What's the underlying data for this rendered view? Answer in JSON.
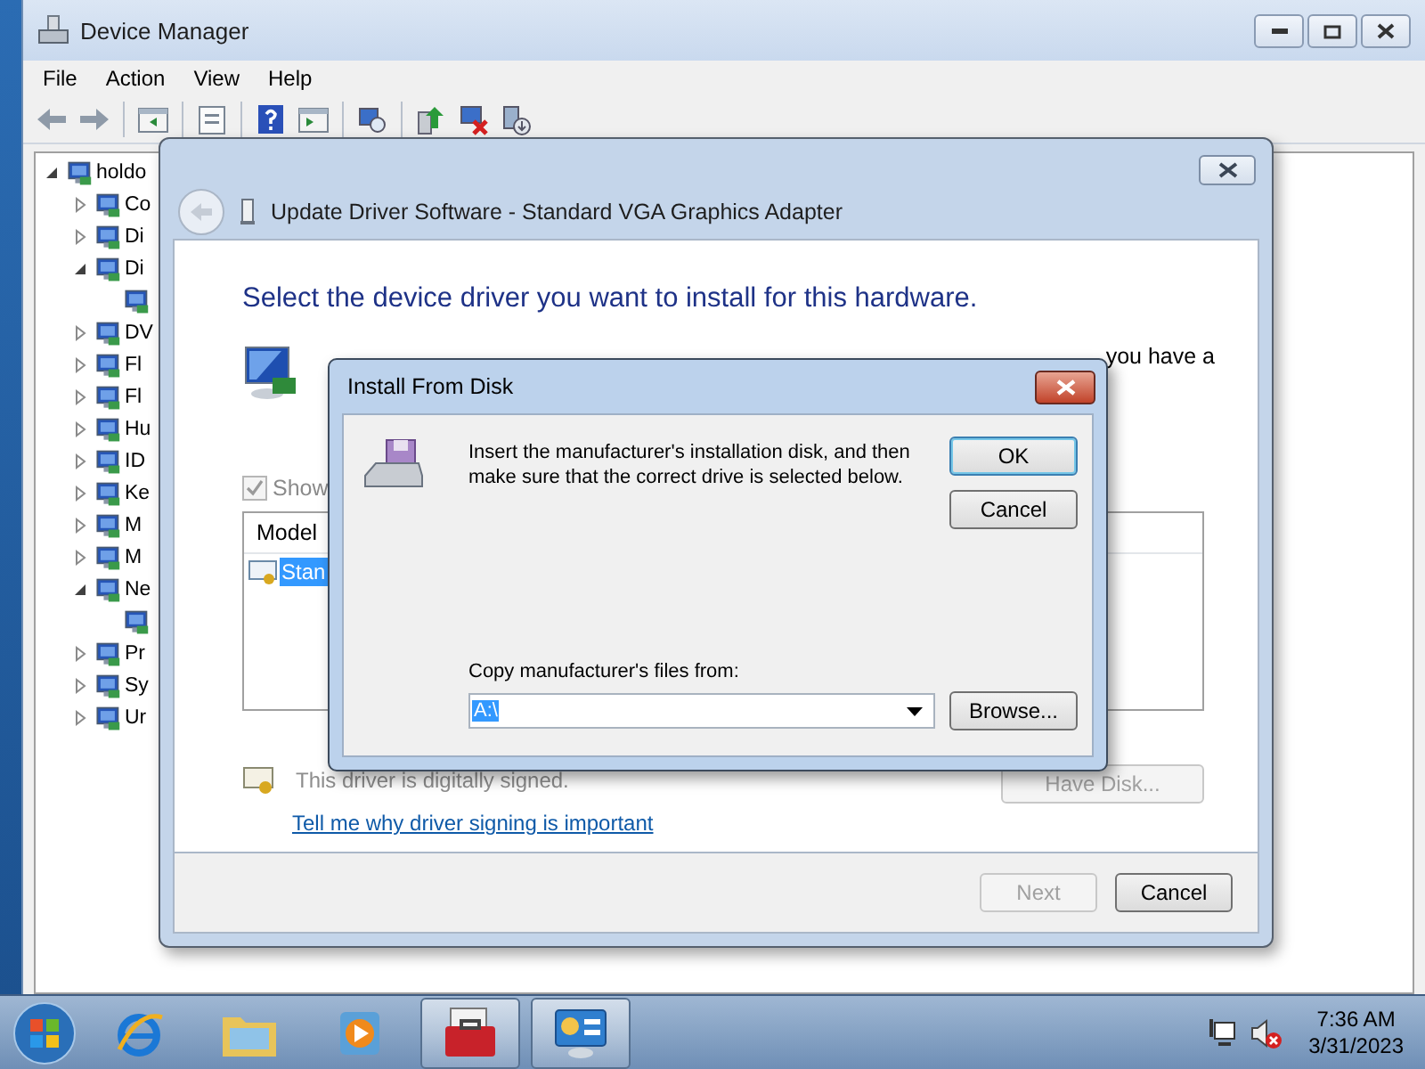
{
  "device_manager": {
    "title": "Device Manager",
    "menu": [
      "File",
      "Action",
      "View",
      "Help"
    ],
    "tree": [
      {
        "label": "holdo",
        "expanded": true,
        "children": [
          {
            "label": "Co",
            "expanded": false
          },
          {
            "label": "Di",
            "expanded": false
          },
          {
            "label": "Di",
            "expanded": true,
            "children": [
              {
                "kind": "device"
              }
            ]
          },
          {
            "label": "DV",
            "expanded": false
          },
          {
            "label": "Fl",
            "expanded": false
          },
          {
            "label": "Fl",
            "expanded": false
          },
          {
            "label": "Hu",
            "expanded": false
          },
          {
            "label": "ID",
            "expanded": false
          },
          {
            "label": "Ke",
            "expanded": false
          },
          {
            "label": "M",
            "expanded": false
          },
          {
            "label": "M",
            "expanded": false
          },
          {
            "label": "Ne",
            "expanded": true,
            "children": [
              {
                "kind": "device"
              }
            ]
          },
          {
            "label": "Pr",
            "expanded": false
          },
          {
            "label": "Sy",
            "expanded": false
          },
          {
            "label": "Ur",
            "expanded": false
          }
        ]
      }
    ]
  },
  "update_driver": {
    "title": "Update Driver Software - Standard VGA Graphics Adapter",
    "heading": "Select the device driver you want to install for this hardware.",
    "description": "you have a",
    "show_compatible": {
      "label": "Show",
      "checked": true,
      "disabled": true
    },
    "list": {
      "columns": [
        "Model"
      ],
      "rows": [
        {
          "label": "Stan",
          "selected": true
        }
      ]
    },
    "signed_text": "This driver is digitally signed.",
    "have_disk": "Have Disk...",
    "link": "Tell me why driver signing is important",
    "buttons": [
      {
        "label": "Next",
        "disabled": true
      },
      {
        "label": "Cancel",
        "disabled": false
      }
    ]
  },
  "install_from_disk": {
    "title": "Install From Disk",
    "message": "Insert the manufacturer's installation disk, and then make sure that the correct drive is selected below.",
    "buttons": [
      {
        "label": "OK",
        "default": true
      },
      {
        "label": "Cancel",
        "default": false
      }
    ],
    "copy_label": "Copy manufacturer's files from:",
    "path": "A:\\",
    "browse": "Browse..."
  },
  "taskbar": {
    "apps": [
      {
        "kind": "browser",
        "active": false
      },
      {
        "kind": "folder",
        "active": false
      },
      {
        "kind": "media",
        "active": false
      },
      {
        "kind": "toolbox",
        "active": true
      },
      {
        "kind": "panel",
        "active": true
      }
    ],
    "tray": {
      "volume_muted": true,
      "time": "7:36 AM",
      "date": "3/31/2023"
    }
  }
}
